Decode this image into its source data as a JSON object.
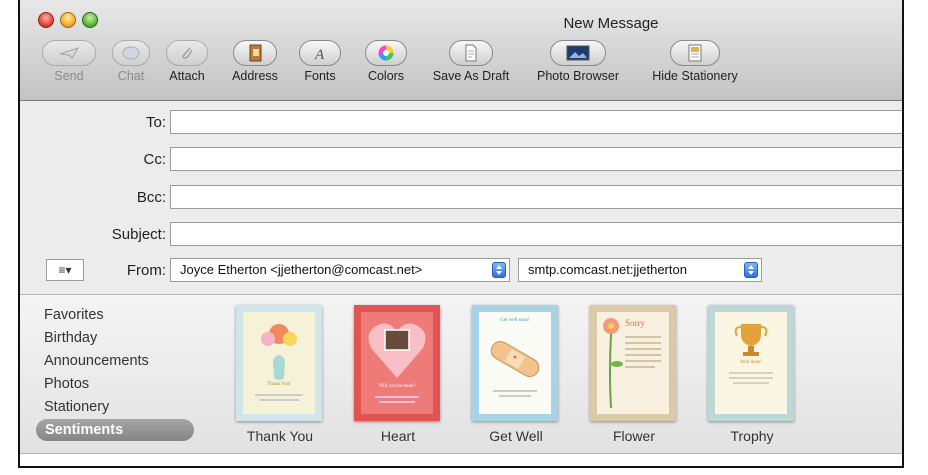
{
  "window": {
    "title": "New Message"
  },
  "toolbar": {
    "send": "Send",
    "chat": "Chat",
    "attach": "Attach",
    "address": "Address",
    "fonts": "Fonts",
    "colors": "Colors",
    "save_draft": "Save As Draft",
    "photo_browser": "Photo Browser",
    "hide_stationery": "Hide Stationery"
  },
  "fields": {
    "to_label": "To:",
    "cc_label": "Cc:",
    "bcc_label": "Bcc:",
    "subject_label": "Subject:",
    "from_label": "From:",
    "account_menu": "≡▾",
    "from_value": "Joyce Etherton <jjetherton@comcast.net>",
    "smtp_value": "smtp.comcast.net:jjetherton"
  },
  "stationery": {
    "categories": [
      "Favorites",
      "Birthday",
      "Announcements",
      "Photos",
      "Stationery",
      "Sentiments"
    ],
    "selected": "Sentiments",
    "templates": [
      "Thank You",
      "Heart",
      "Get Well",
      "Flower",
      "Trophy"
    ],
    "thumb_text": {
      "thank_you": "Thank You!",
      "heart": "Will you be mine?",
      "get_well": "Get well soon!",
      "flower": "Sorry",
      "trophy": "Well done!"
    }
  }
}
